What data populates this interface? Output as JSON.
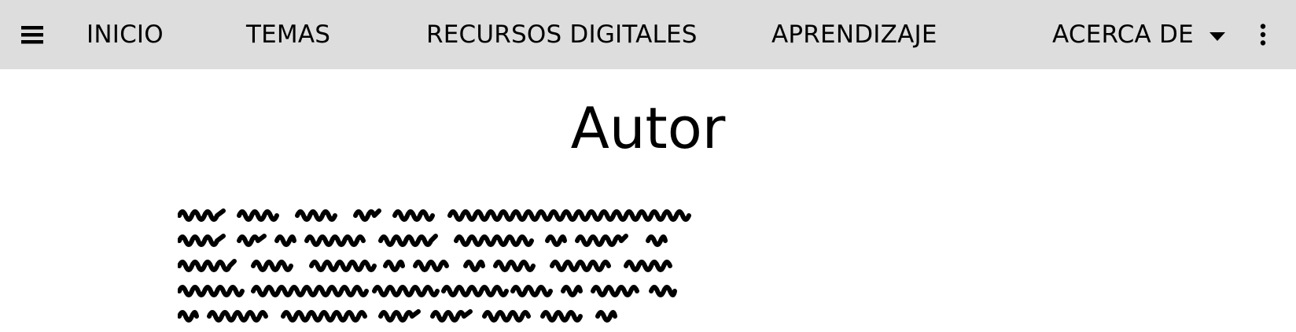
{
  "navbar": {
    "menu_icon": "hamburger-menu-icon",
    "more_icon": "vertical-dots-more-icon",
    "dropdown_icon": "caret-down-icon",
    "items": [
      {
        "label": "INICIO"
      },
      {
        "label": "TEMAS"
      },
      {
        "label": "RECURSOS DIGITALES"
      },
      {
        "label": "APRENDIZAJE"
      },
      {
        "label": "ACERCA DE"
      }
    ]
  },
  "main": {
    "title": "Autor"
  },
  "colors": {
    "navbar_bg": "#dddddd",
    "page_bg": "#ffffff",
    "text": "#000000"
  }
}
